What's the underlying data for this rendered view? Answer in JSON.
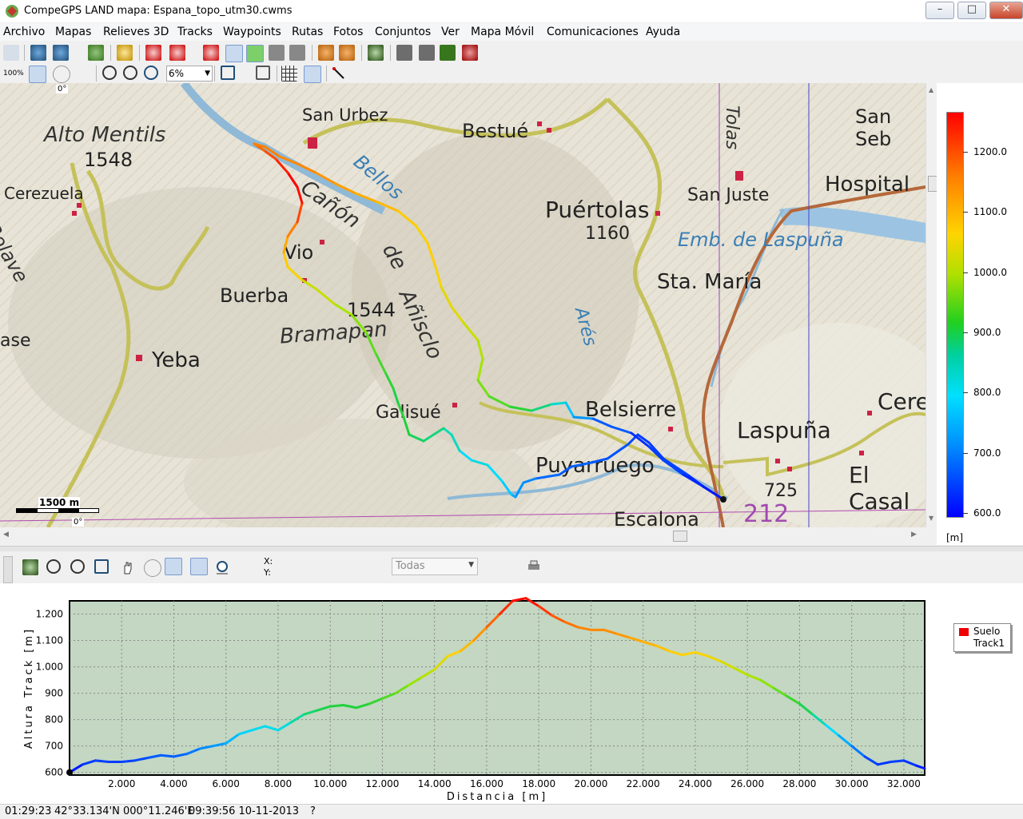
{
  "window": {
    "title": "CompeGPS LAND mapa: Espana_topo_utm30.cwms",
    "minimize": "–",
    "maximize": "□",
    "close": "✕"
  },
  "menu": [
    "Archivo",
    "Mapas",
    "Relieves 3D",
    "Tracks",
    "Waypoints",
    "Rutas",
    "Fotos",
    "Conjuntos",
    "Ver",
    "Mapa Móvil",
    "Comunicaciones",
    "Ayuda"
  ],
  "toolbar2": {
    "zoom_label": "6%",
    "scale_label": "100%"
  },
  "map": {
    "rotation_top": "0°",
    "rotation_bottom": "0°",
    "scalebar": "1500 m",
    "labels": [
      "Alto Mentils",
      "1548",
      "San Urbez",
      "Bestué",
      "Cerezuela",
      "Bolave",
      "Cañón",
      "de",
      "Añisclo",
      "Bellos",
      "Puértolas",
      "1160",
      "San Juste",
      "Hospital",
      "San Seb",
      "Emb. de Laspuña",
      "Sta. María",
      "Vio",
      "Buerba",
      "1544",
      "Bramapan",
      "ase",
      "Yeba",
      "Galisué",
      "Belsierre",
      "Laspuña",
      "Ceres",
      "El Casal",
      "Puyarruego",
      "725",
      "Escalona",
      "212",
      "Arés",
      "Tolas"
    ]
  },
  "legend": {
    "ticks": [
      "1200.0",
      "1100.0",
      "1000.0",
      "900.0",
      "800.0",
      "700.0",
      "600.0"
    ],
    "unit": "[m]"
  },
  "profile_toolbar": {
    "x_label": "X:",
    "y_label": "Y:",
    "dropdown": "Todas"
  },
  "chart_data": {
    "type": "line",
    "xlabel": "Distancia  [m]",
    "ylabel": "Altura  Track  [m]",
    "xlim": [
      0,
      32800
    ],
    "ylim": [
      590,
      1250
    ],
    "xticks": [
      "2.000",
      "4.000",
      "6.000",
      "8.000",
      "10.000",
      "12.000",
      "14.000",
      "16.000",
      "18.000",
      "20.000",
      "22.000",
      "24.000",
      "26.000",
      "28.000",
      "30.000",
      "32.000"
    ],
    "yticks": [
      "600",
      "700",
      "800",
      "900",
      "1.000",
      "1.100",
      "1.200"
    ],
    "legend": [
      "Suelo",
      "Track1"
    ],
    "grid": true,
    "x": [
      0,
      500,
      1000,
      1500,
      2000,
      2500,
      3000,
      3500,
      4000,
      4500,
      5000,
      5500,
      6000,
      6500,
      7000,
      7500,
      8000,
      8500,
      9000,
      9500,
      10000,
      10500,
      11000,
      11500,
      12000,
      12500,
      13000,
      13500,
      14000,
      14500,
      15000,
      15500,
      16000,
      16500,
      17000,
      17500,
      18000,
      18500,
      19000,
      19500,
      20000,
      20500,
      21000,
      21500,
      22000,
      22500,
      23000,
      23500,
      24000,
      24500,
      25000,
      25500,
      26000,
      26500,
      27000,
      27500,
      28000,
      28500,
      29000,
      29500,
      30000,
      30500,
      31000,
      31500,
      32000,
      32500,
      32800
    ],
    "values": [
      600,
      630,
      645,
      640,
      640,
      645,
      655,
      665,
      660,
      670,
      690,
      700,
      710,
      745,
      760,
      775,
      760,
      790,
      820,
      835,
      850,
      855,
      845,
      860,
      880,
      900,
      930,
      960,
      990,
      1040,
      1060,
      1100,
      1150,
      1200,
      1250,
      1260,
      1230,
      1195,
      1170,
      1150,
      1140,
      1140,
      1125,
      1110,
      1095,
      1080,
      1060,
      1045,
      1055,
      1040,
      1020,
      995,
      970,
      950,
      920,
      890,
      860,
      820,
      780,
      740,
      700,
      660,
      630,
      640,
      645,
      625,
      615
    ]
  }
}
